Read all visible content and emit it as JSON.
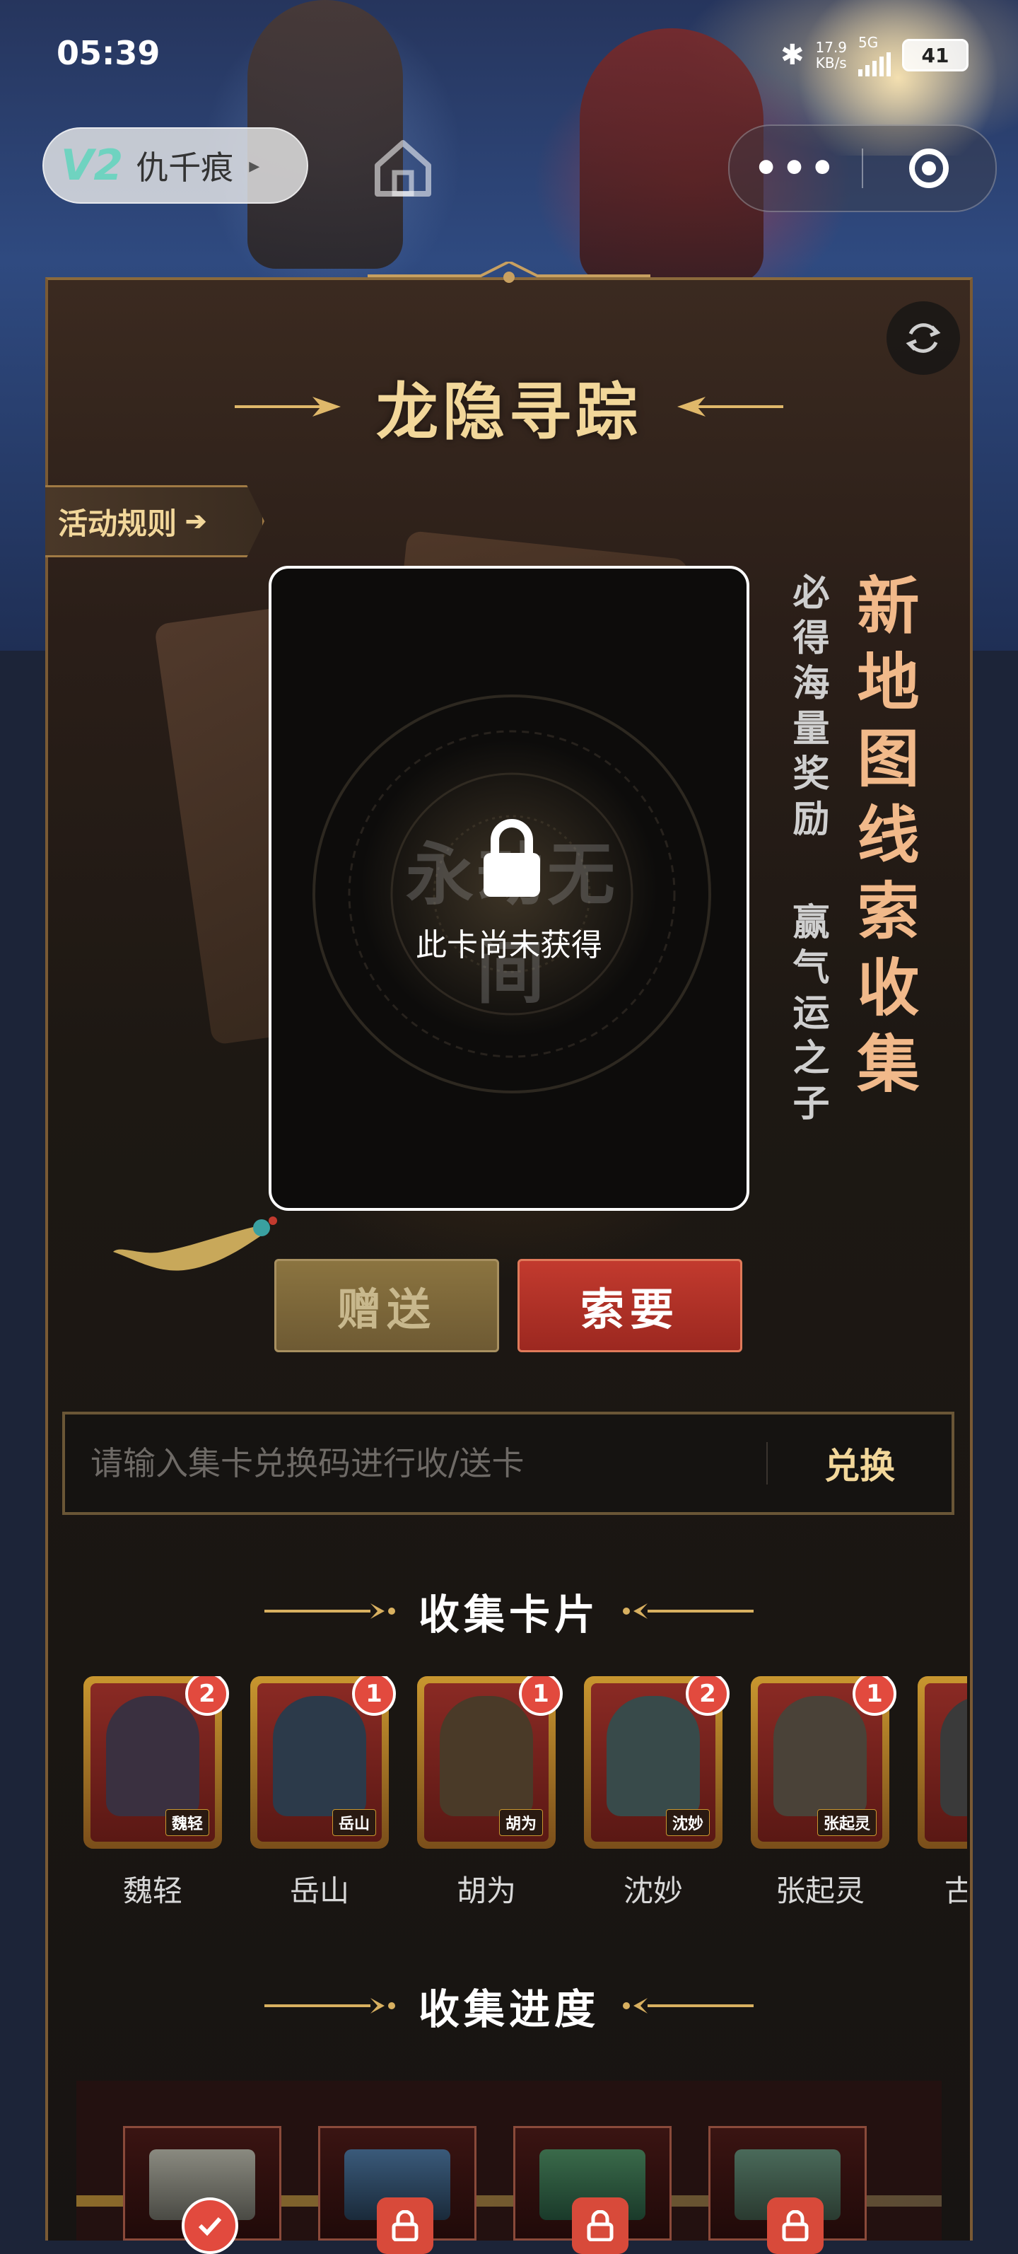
{
  "status_bar": {
    "time": "05:39",
    "net_speed": "17.9",
    "net_unit": "KB/s",
    "network_type": "5G",
    "battery": "41"
  },
  "nav": {
    "vip_badge": "V2",
    "username": "仇千痕"
  },
  "event": {
    "title": "龙隐寻踪",
    "rules_label": "活动规则",
    "card_locked_text": "此卡尚未获得",
    "watermark": "永劫无间",
    "headline": "新地图线索收集",
    "tagline_1": "必得海量奖励",
    "tagline_2": "赢气运之子"
  },
  "actions": {
    "gift_label": "赠送",
    "ask_label": "索要"
  },
  "redeem": {
    "placeholder": "请输入集卡兑换码进行收/送卡",
    "button_label": "兑换"
  },
  "collection": {
    "title": "收集卡片",
    "cards": [
      {
        "name": "魏轻",
        "count": "2",
        "art_color": "#3a3040"
      },
      {
        "name": "岳山",
        "count": "1",
        "art_color": "#2c3a4a"
      },
      {
        "name": "胡为",
        "count": "1",
        "art_color": "#4a3a28"
      },
      {
        "name": "沈妙",
        "count": "2",
        "art_color": "#384a4a"
      },
      {
        "name": "张起灵",
        "count": "1",
        "art_color": "#4a4238"
      },
      {
        "name": "古",
        "count": "",
        "art_color": "#3a3a3a"
      }
    ]
  },
  "progress": {
    "title": "收集进度",
    "milestones_collected": 1,
    "milestones_total": 4
  },
  "colors": {
    "gold": "#f2d79a",
    "accent_red": "#c23a2e",
    "badge_red": "#e24a3e"
  }
}
